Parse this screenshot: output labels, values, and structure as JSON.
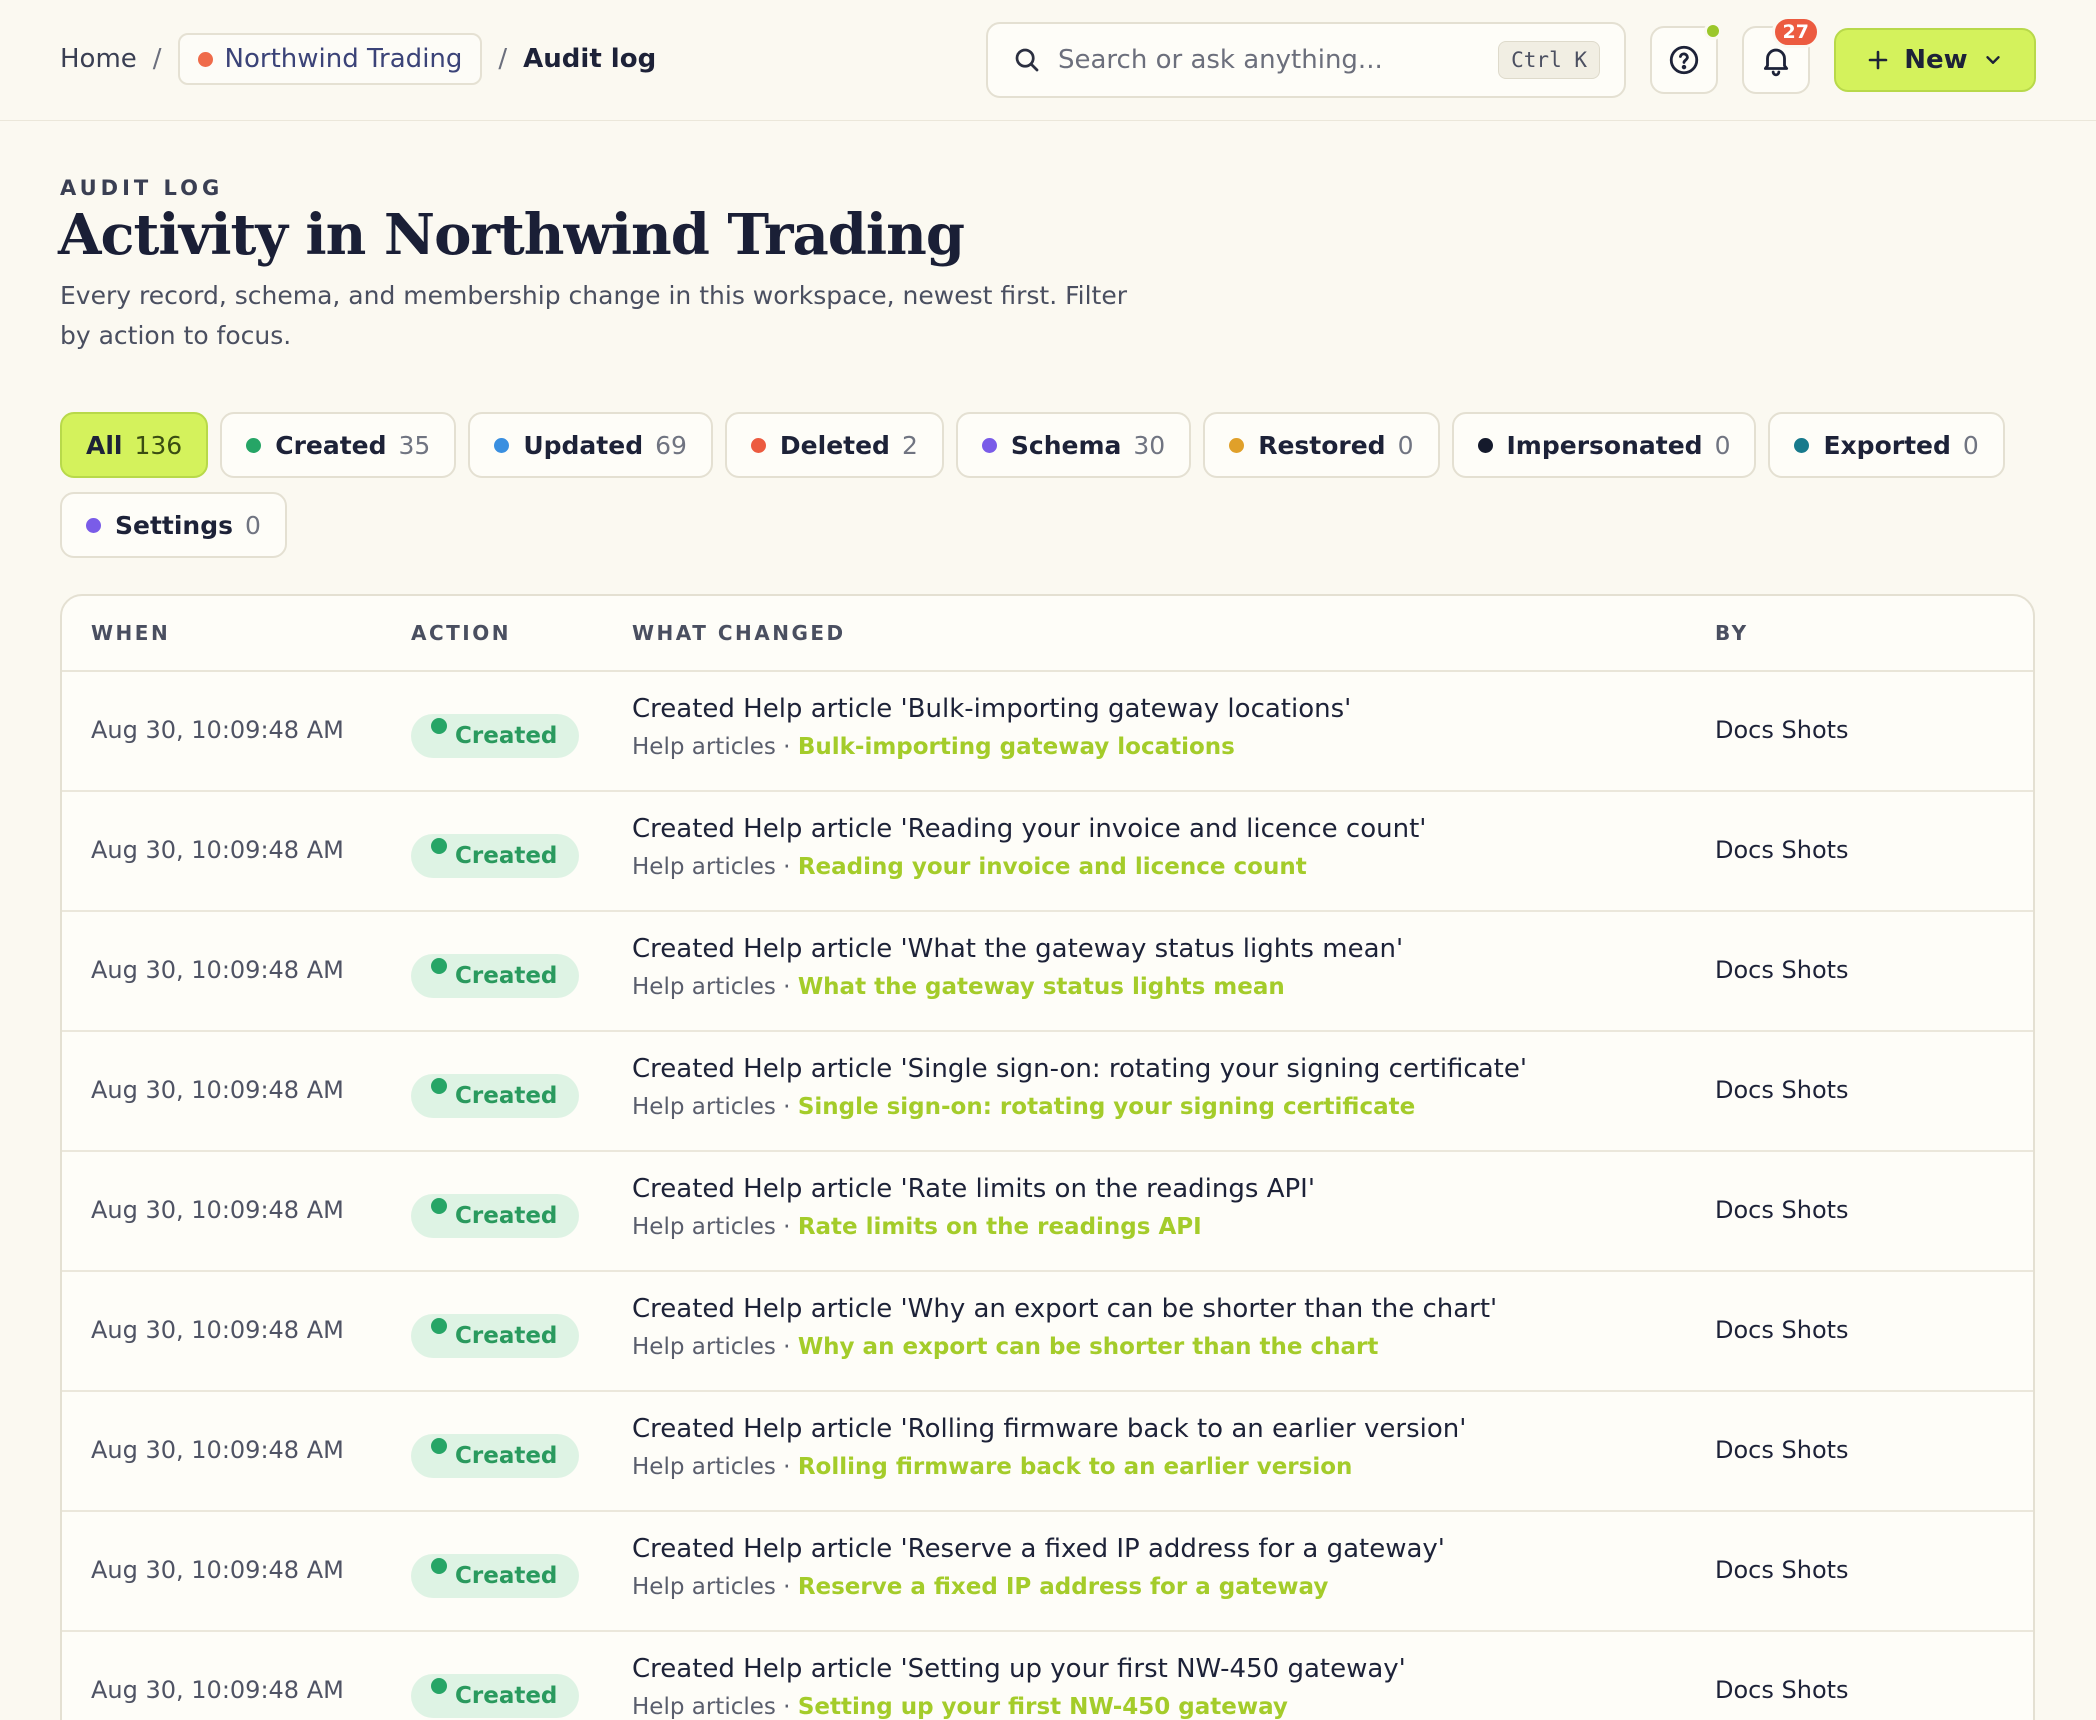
{
  "breadcrumb": {
    "home": "Home",
    "separator": "/",
    "workspace": "Northwind Trading",
    "current": "Audit log"
  },
  "search": {
    "placeholder": "Search or ask anything...",
    "shortcut": "Ctrl K"
  },
  "notifications": {
    "count": "27"
  },
  "new_button": {
    "label": "New"
  },
  "header": {
    "eyebrow": "AUDIT LOG",
    "title": "Activity in Northwind Trading",
    "description": "Every record, schema, and membership change in this workspace, newest first. Filter by action to focus."
  },
  "filters": [
    {
      "label": "All",
      "count": "136",
      "color": ""
    },
    {
      "label": "Created",
      "count": "35",
      "color": "#26a566"
    },
    {
      "label": "Updated",
      "count": "69",
      "color": "#3a8fe0"
    },
    {
      "label": "Deleted",
      "count": "2",
      "color": "#ec5b40"
    },
    {
      "label": "Schema",
      "count": "30",
      "color": "#7a5ce8"
    },
    {
      "label": "Restored",
      "count": "0",
      "color": "#e0a02a"
    },
    {
      "label": "Impersonated",
      "count": "0",
      "color": "#151a2c"
    },
    {
      "label": "Exported",
      "count": "0",
      "color": "#187a8c"
    },
    {
      "label": "Settings",
      "count": "0",
      "color": "#7a5ce8"
    }
  ],
  "table": {
    "columns": {
      "when": "WHEN",
      "action": "ACTION",
      "what": "WHAT CHANGED",
      "by": "BY"
    },
    "rows": [
      {
        "when": "Aug 30, 10:09:48 AM",
        "action": "Created",
        "title": "Created Help article 'Bulk-importing gateway locations'",
        "collection": "Help articles",
        "link": "Bulk-importing gateway locations",
        "by": "Docs Shots"
      },
      {
        "when": "Aug 30, 10:09:48 AM",
        "action": "Created",
        "title": "Created Help article 'Reading your invoice and licence count'",
        "collection": "Help articles",
        "link": "Reading your invoice and licence count",
        "by": "Docs Shots"
      },
      {
        "when": "Aug 30, 10:09:48 AM",
        "action": "Created",
        "title": "Created Help article 'What the gateway status lights mean'",
        "collection": "Help articles",
        "link": "What the gateway status lights mean",
        "by": "Docs Shots"
      },
      {
        "when": "Aug 30, 10:09:48 AM",
        "action": "Created",
        "title": "Created Help article 'Single sign-on: rotating your signing certificate'",
        "collection": "Help articles",
        "link": "Single sign-on: rotating your signing certificate",
        "by": "Docs Shots"
      },
      {
        "when": "Aug 30, 10:09:48 AM",
        "action": "Created",
        "title": "Created Help article 'Rate limits on the readings API'",
        "collection": "Help articles",
        "link": "Rate limits on the readings API",
        "by": "Docs Shots"
      },
      {
        "when": "Aug 30, 10:09:48 AM",
        "action": "Created",
        "title": "Created Help article 'Why an export can be shorter than the chart'",
        "collection": "Help articles",
        "link": "Why an export can be shorter than the chart",
        "by": "Docs Shots"
      },
      {
        "when": "Aug 30, 10:09:48 AM",
        "action": "Created",
        "title": "Created Help article 'Rolling firmware back to an earlier version'",
        "collection": "Help articles",
        "link": "Rolling firmware back to an earlier version",
        "by": "Docs Shots"
      },
      {
        "when": "Aug 30, 10:09:48 AM",
        "action": "Created",
        "title": "Created Help article 'Reserve a fixed IP address for a gateway'",
        "collection": "Help articles",
        "link": "Reserve a fixed IP address for a gateway",
        "by": "Docs Shots"
      },
      {
        "when": "Aug 30, 10:09:48 AM",
        "action": "Created",
        "title": "Created Help article 'Setting up your first NW-450 gateway'",
        "collection": "Help articles",
        "link": "Setting up your first NW-450 gateway",
        "by": "Docs Shots"
      }
    ]
  },
  "colors": {
    "accent": "#d4f25c",
    "created": "#26a566",
    "link": "#a4cc2a",
    "danger": "#ec5b40"
  }
}
